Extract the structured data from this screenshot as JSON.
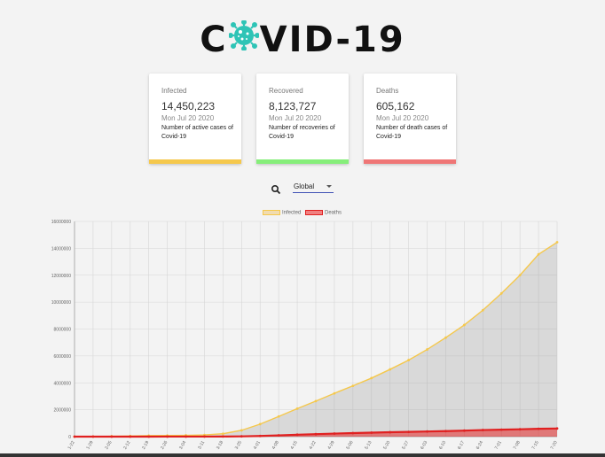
{
  "header": {
    "title_left": "C",
    "title_right": "VID-19"
  },
  "cards": [
    {
      "label": "Infected",
      "value": "14,450,223",
      "date": "Mon Jul 20 2020",
      "desc": "Number of active cases of Covid-19",
      "color": "#f5c84c"
    },
    {
      "label": "Recovered",
      "value": "8,123,727",
      "date": "Mon Jul 20 2020",
      "desc": "Number of recoveries of Covid-19",
      "color": "#86ee7a"
    },
    {
      "label": "Deaths",
      "value": "605,162",
      "date": "Mon Jul 20 2020",
      "desc": "Number of death cases of Covid-19",
      "color": "#ef7676"
    }
  ],
  "controls": {
    "search_icon": "search-icon",
    "country_select": "Global"
  },
  "chart_data": {
    "type": "line",
    "legend": [
      "Infected",
      "Deaths"
    ],
    "legend_position": "top-center",
    "grid": true,
    "ylim": [
      0,
      16000000
    ],
    "y_ticks": [
      "0",
      "2000000",
      "4000000",
      "6000000",
      "8000000",
      "10000000",
      "12000000",
      "14000000",
      "16000000"
    ],
    "x": [
      "1-22",
      "1-29",
      "2-05",
      "2-12",
      "2-19",
      "2-26",
      "3-04",
      "3-11",
      "3-18",
      "3-25",
      "4-01",
      "4-08",
      "4-15",
      "4-22",
      "4-29",
      "5-06",
      "5-13",
      "5-20",
      "5-27",
      "6-03",
      "6-10",
      "6-17",
      "6-24",
      "7-01",
      "7-08",
      "7-15",
      "7-20"
    ],
    "series": [
      {
        "name": "Infected",
        "color": "#f5c84c",
        "values": [
          600,
          6000,
          28000,
          45000,
          76000,
          83000,
          95000,
          125000,
          215000,
          470000,
          930000,
          1500000,
          2080000,
          2640000,
          3220000,
          3780000,
          4350000,
          5000000,
          5690000,
          6480000,
          7360000,
          8300000,
          9400000,
          10650000,
          12000000,
          13550000,
          14450223
        ]
      },
      {
        "name": "Deaths",
        "color": "#e02020",
        "values": [
          17,
          130,
          560,
          1100,
          2200,
          2800,
          3300,
          4600,
          9000,
          22000,
          47000,
          95000,
          145000,
          184000,
          227000,
          264000,
          296000,
          330000,
          356000,
          383000,
          410000,
          448000,
          491000,
          518000,
          548000,
          585000,
          605162
        ]
      }
    ]
  }
}
